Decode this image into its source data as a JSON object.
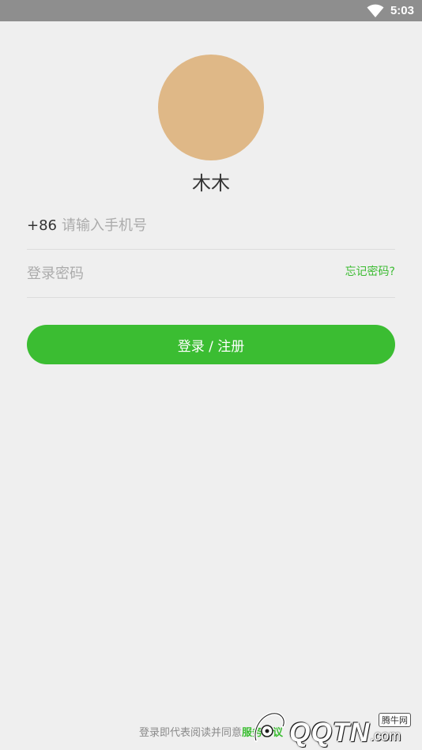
{
  "status_bar": {
    "time": "5:03",
    "wifi_icon": "wifi-icon"
  },
  "profile": {
    "avatar_color": "#dfb887",
    "name": "木木"
  },
  "phone_field": {
    "prefix": "+86",
    "placeholder": "请输入手机号",
    "value": ""
  },
  "password_field": {
    "placeholder": "登录密码",
    "value": "",
    "forgot_label": "忘记密码?"
  },
  "login_button": {
    "label": "登录 / 注册",
    "color": "#3bbd32"
  },
  "agreement": {
    "text": "登录即代表阅读并同意",
    "link": "服务协议"
  },
  "watermark": {
    "text": "QQTN",
    "suffix": ".com",
    "badge": "腾牛网"
  }
}
